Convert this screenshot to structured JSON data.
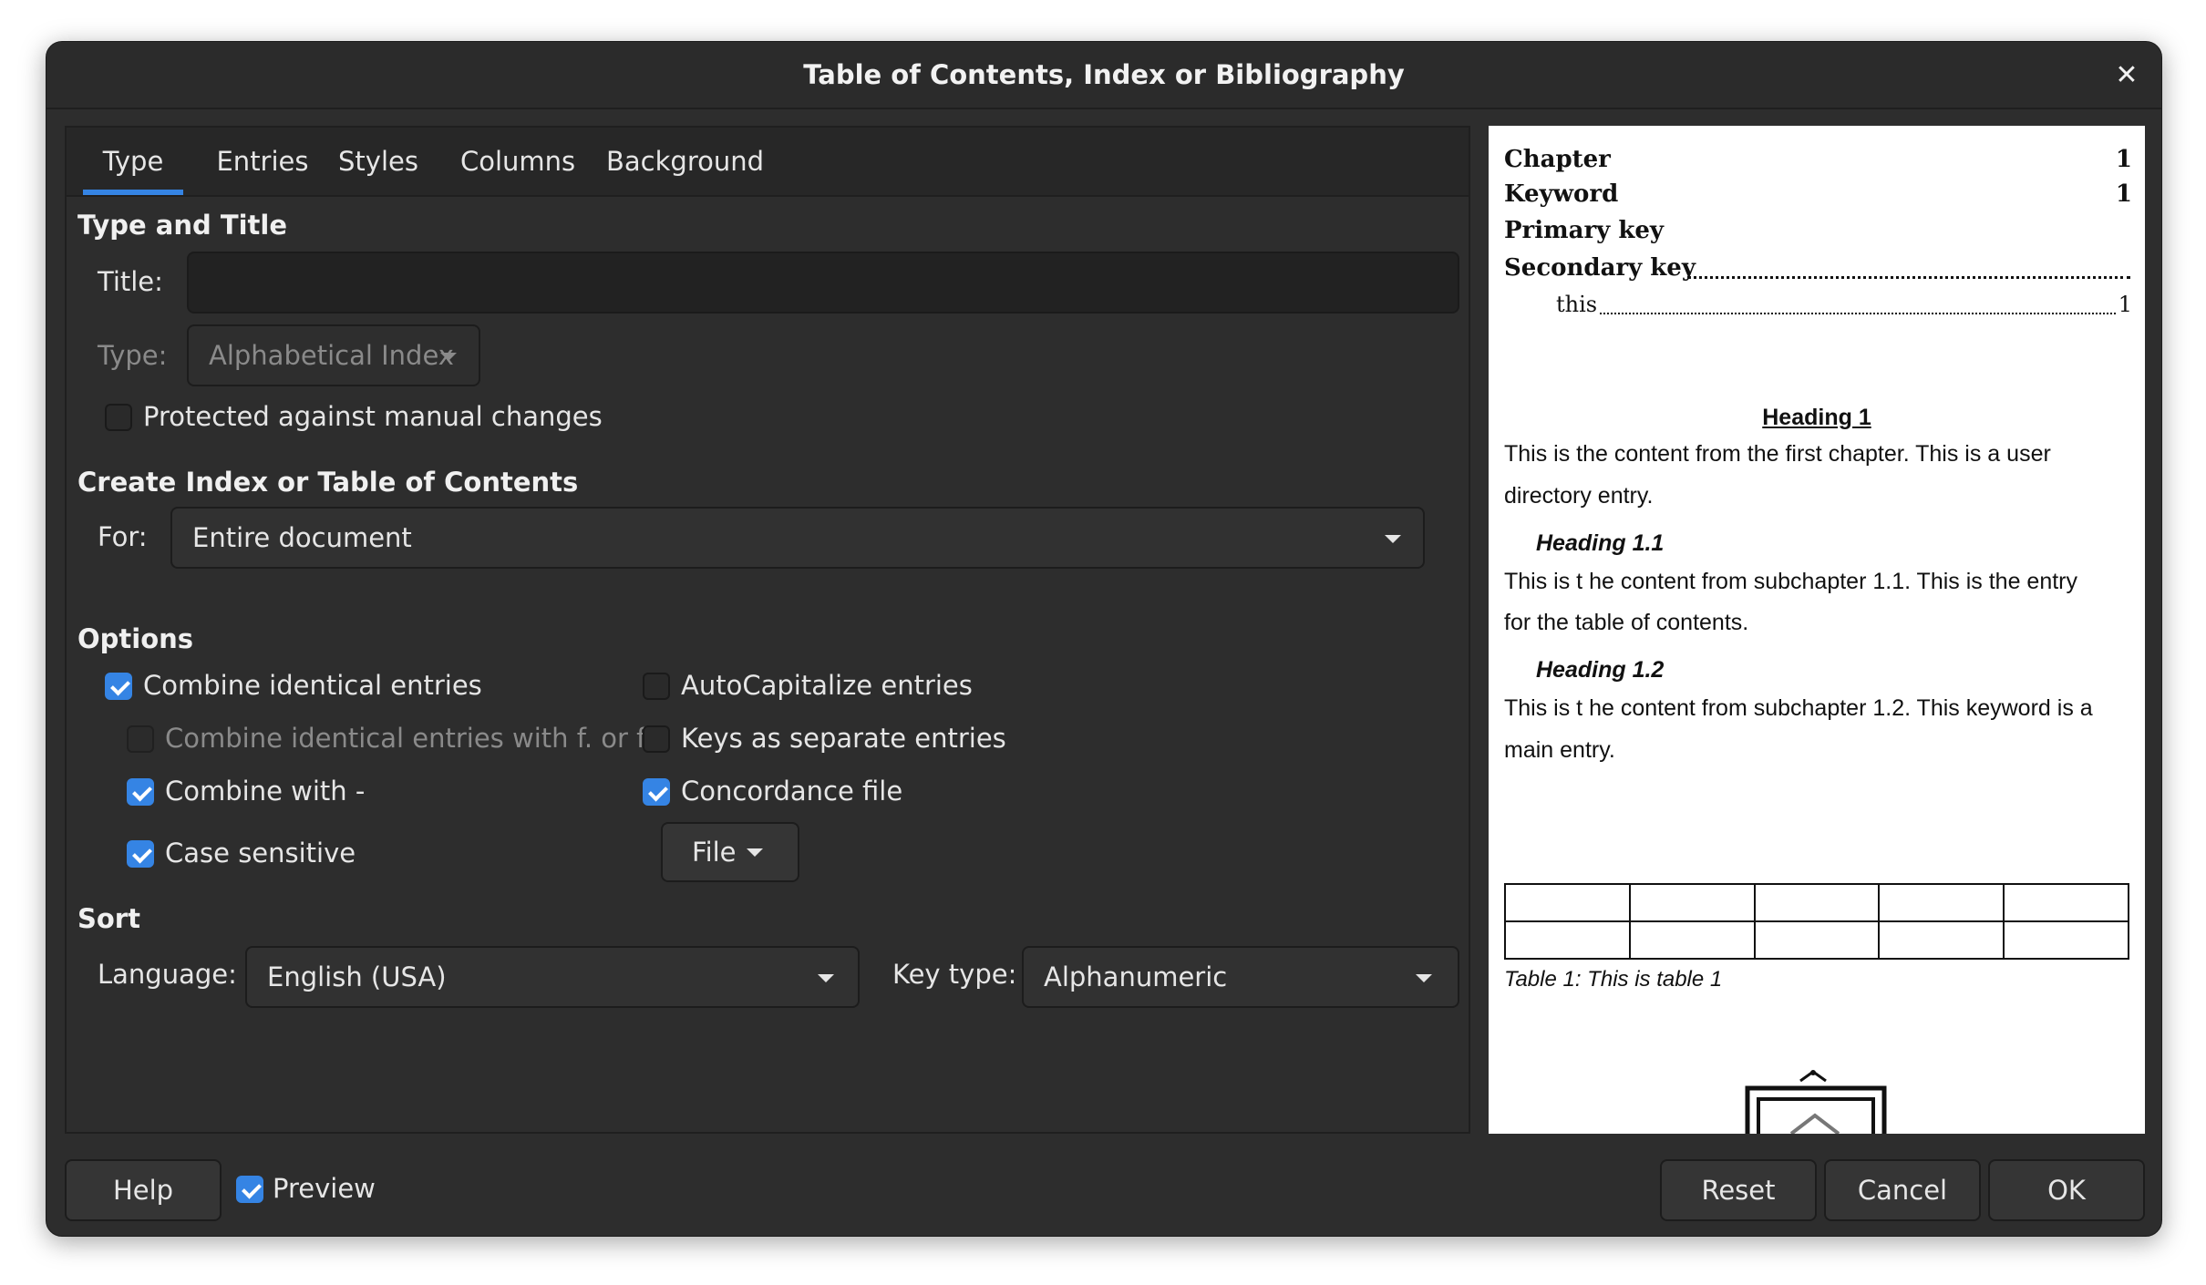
{
  "dialog": {
    "title": "Table of Contents, Index or Bibliography",
    "close_glyph": "✕"
  },
  "tabs": [
    {
      "label": "Type",
      "active": true
    },
    {
      "label": "Entries",
      "active": false
    },
    {
      "label": "Styles",
      "active": false
    },
    {
      "label": "Columns",
      "active": false
    },
    {
      "label": "Background",
      "active": false
    }
  ],
  "type_and_title": {
    "heading": "Type and Title",
    "title_label": "Title:",
    "title_value": "",
    "type_label": "Type:",
    "type_value": "Alphabetical Index",
    "protected_label": "Protected against manual changes",
    "protected_checked": false
  },
  "create_index": {
    "heading": "Create Index or Table of Contents",
    "for_label": "For:",
    "for_value": "Entire document"
  },
  "options": {
    "heading": "Options",
    "combine_identical": {
      "label": "Combine identical entries",
      "checked": true
    },
    "combine_ff": {
      "label": "Combine identical entries with f. or ff.",
      "checked": false,
      "enabled": false
    },
    "combine_with": {
      "label": "Combine with -",
      "checked": true
    },
    "case_sensitive": {
      "label": "Case sensitive",
      "checked": true
    },
    "autocapitalize": {
      "label": "AutoCapitalize entries",
      "checked": false
    },
    "keys_separate": {
      "label": "Keys as separate entries",
      "checked": false
    },
    "concordance": {
      "label": "Concordance file",
      "checked": true
    },
    "file_button": "File"
  },
  "sort": {
    "heading": "Sort",
    "language_label": "Language:",
    "language_value": "English (USA)",
    "key_type_label": "Key type:",
    "key_type_value": "Alphanumeric"
  },
  "preview": {
    "index": [
      {
        "text": "Chapter",
        "page": "1"
      },
      {
        "text": "Keyword",
        "page": "1"
      },
      {
        "text": "Primary key",
        "page": ""
      },
      {
        "text": "Secondary key",
        "page": ""
      },
      {
        "text": "this",
        "page": "1"
      }
    ],
    "heading1": "Heading 1",
    "para1_line1": "This is  the content from the first chapter. This is a user",
    "para1_line2": "directory entry.",
    "heading11": "Heading 1.1",
    "para2_line1": "This is t he content from subchapter 1.1. This is the entry",
    "para2_line2": "for the table of contents.",
    "heading12": "Heading 1.2",
    "para3_line1": "This is t he content from subchapter 1.2. This keyword is a",
    "para3_line2": "main entry.",
    "table_caption": "Table 1: This is table 1"
  },
  "footer": {
    "help": "Help",
    "preview_label": "Preview",
    "preview_checked": true,
    "reset": "Reset",
    "cancel": "Cancel",
    "ok": "OK"
  },
  "colors": {
    "accent": "#3584e4",
    "dialog_bg": "#2d2d2d",
    "preview_bg": "#ffffff"
  }
}
